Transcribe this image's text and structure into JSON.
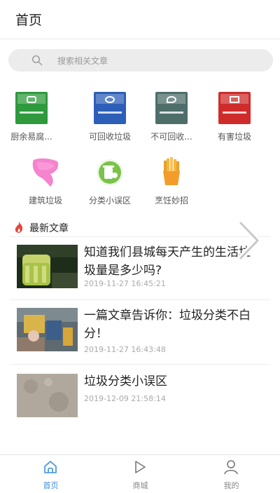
{
  "header": {
    "title": "首页"
  },
  "search": {
    "placeholder": "搜索相关文章"
  },
  "categories": [
    {
      "label": "厨余易腐...",
      "icon": "kitchen-waste-bin-icon",
      "color": "#2e9a3c"
    },
    {
      "label": "可回收垃圾",
      "icon": "recyclable-bin-icon",
      "color": "#2d5fb8"
    },
    {
      "label": "不可回收...",
      "icon": "non-recyclable-bin-icon",
      "color": "#4e6e6a"
    },
    {
      "label": "有害垃圾",
      "icon": "hazardous-bin-icon",
      "color": "#cf2b2b"
    },
    {
      "label": "建筑垃圾",
      "icon": "construction-waste-icon",
      "color": "#f06bc6"
    },
    {
      "label": "分类小误区",
      "icon": "sorting-mistakes-icon",
      "color": "#4caf50"
    },
    {
      "label": "烹饪妙招",
      "icon": "cooking-tips-icon",
      "color": "#f2a33a"
    }
  ],
  "section": {
    "title": "最新文章",
    "icon": "fire-icon"
  },
  "articles": [
    {
      "title": "知道我们县城每天产生的生活垃圾量是多少吗?",
      "time": "2019-11-27 16:45:21"
    },
    {
      "title": "一篇文章告诉你：垃圾分类不白分！",
      "time": "2019-11-27 16:43:48"
    },
    {
      "title": "垃圾分类小误区",
      "time": "2019-12-09 21:58:14"
    }
  ],
  "tabs": [
    {
      "label": "首页",
      "icon": "home-icon",
      "active": true
    },
    {
      "label": "商城",
      "icon": "play-icon",
      "active": false
    },
    {
      "label": "我的",
      "icon": "user-icon",
      "active": false
    }
  ],
  "colors": {
    "accent": "#3a8fe0",
    "fire": "#e8443a"
  }
}
